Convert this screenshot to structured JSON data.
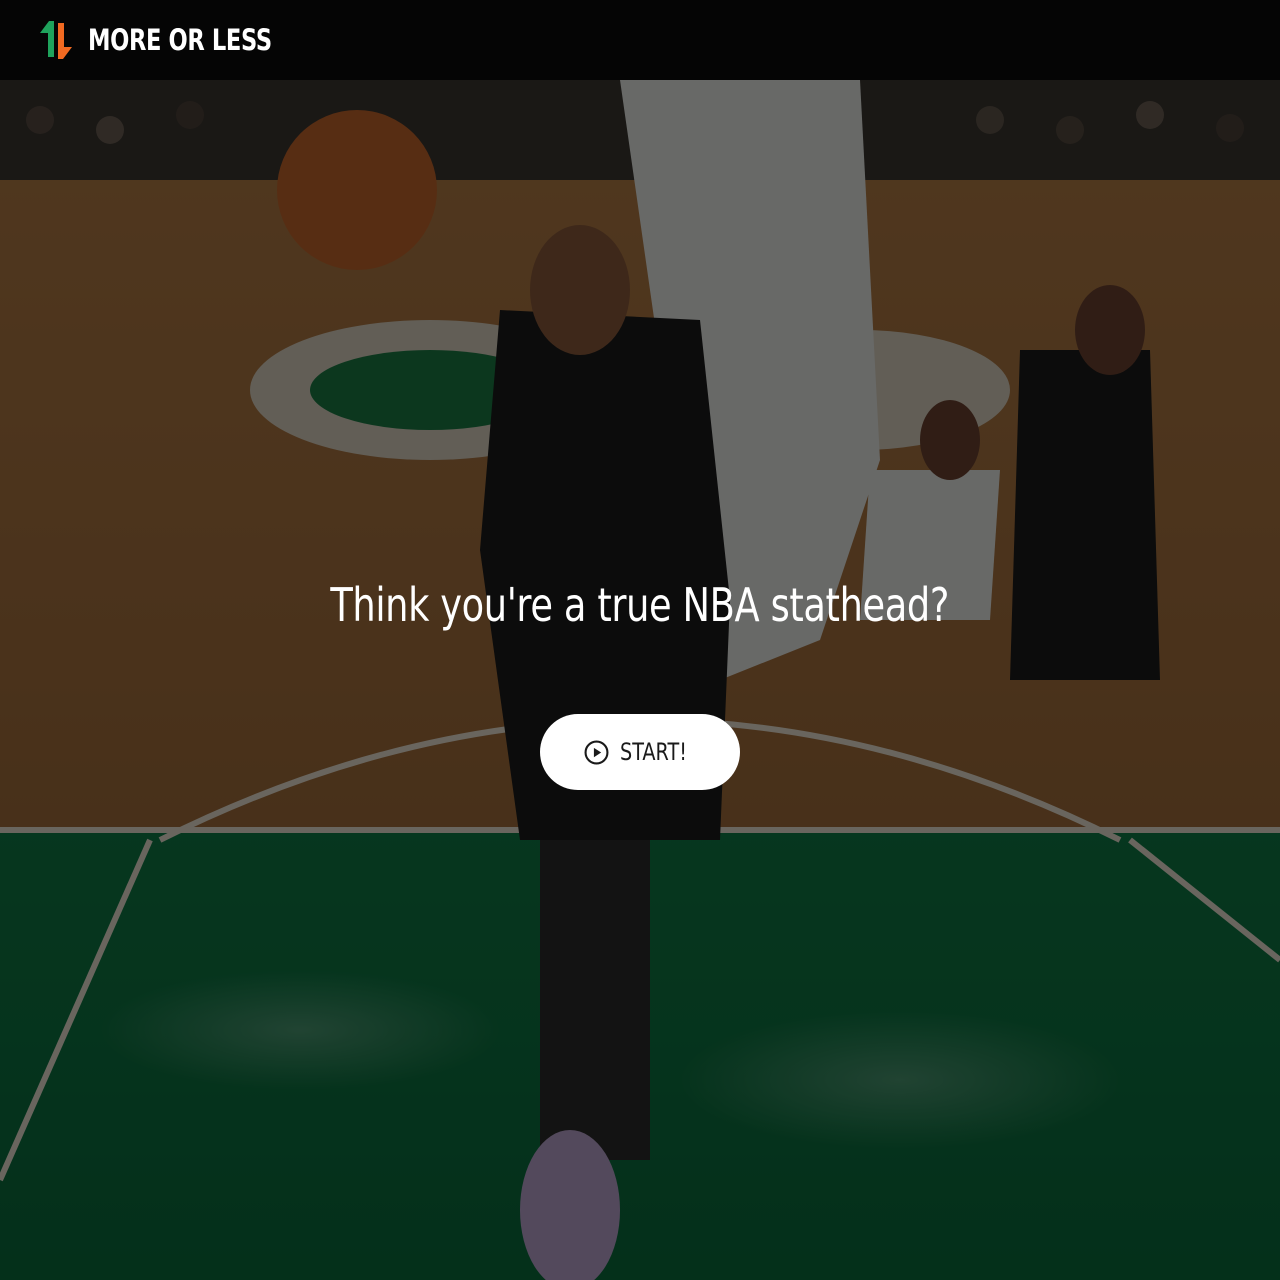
{
  "header": {
    "brand": "MORE OR LESS",
    "logo_icon": "up-down-arrows-icon"
  },
  "hero": {
    "background_image": "basketball-game-photo",
    "headline": "Think you're a true NBA stathead?"
  },
  "start_button": {
    "label": "START!",
    "icon": "play-circle-icon"
  },
  "colors": {
    "brand_green": "#1fa35c",
    "brand_orange": "#f26a21",
    "header_bg": "#050505",
    "button_bg": "#ffffff"
  }
}
